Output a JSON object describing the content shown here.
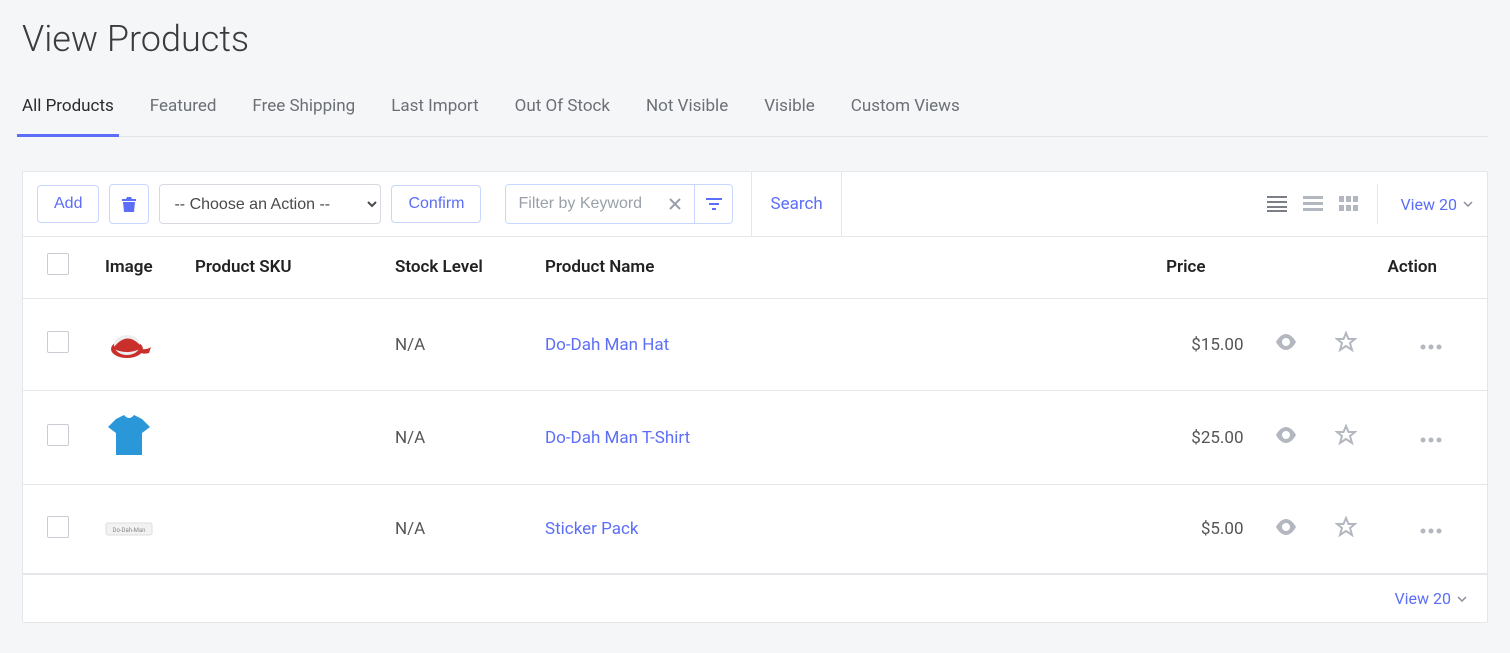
{
  "page_title": "View Products",
  "tabs": [
    {
      "label": "All Products",
      "active": true
    },
    {
      "label": "Featured",
      "active": false
    },
    {
      "label": "Free Shipping",
      "active": false
    },
    {
      "label": "Last Import",
      "active": false
    },
    {
      "label": "Out Of Stock",
      "active": false
    },
    {
      "label": "Not Visible",
      "active": false
    },
    {
      "label": "Visible",
      "active": false
    },
    {
      "label": "Custom Views",
      "active": false
    }
  ],
  "toolbar": {
    "add_label": "Add",
    "action_placeholder": "-- Choose an Action --",
    "confirm_label": "Confirm",
    "filter_placeholder": "Filter by Keyword",
    "search_label": "Search",
    "view_count_label": "View 20"
  },
  "columns": {
    "image": "Image",
    "sku": "Product SKU",
    "stock": "Stock Level",
    "name": "Product Name",
    "price": "Price",
    "action": "Action"
  },
  "rows": [
    {
      "sku": "",
      "stock": "N/A",
      "name": "Do-Dah Man Hat",
      "price": "$15.00",
      "image": "hat"
    },
    {
      "sku": "",
      "stock": "N/A",
      "name": "Do-Dah Man T-Shirt",
      "price": "$25.00",
      "image": "tshirt"
    },
    {
      "sku": "",
      "stock": "N/A",
      "name": "Sticker Pack",
      "price": "$5.00",
      "image": "sticker"
    }
  ],
  "footer": {
    "view_count_label": "View 20"
  }
}
